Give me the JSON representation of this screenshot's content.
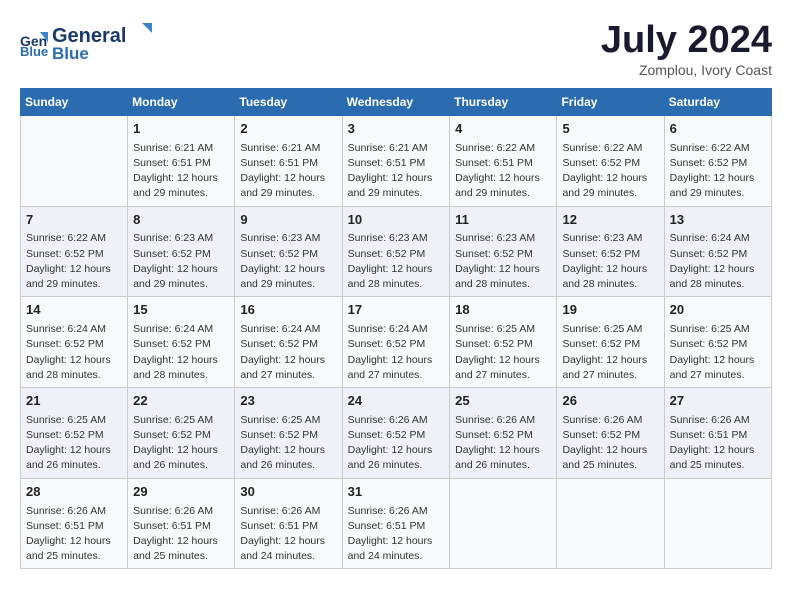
{
  "header": {
    "logo_line1": "General",
    "logo_line2": "Blue",
    "month_year": "July 2024",
    "location": "Zomplou, Ivory Coast"
  },
  "days_of_week": [
    "Sunday",
    "Monday",
    "Tuesday",
    "Wednesday",
    "Thursday",
    "Friday",
    "Saturday"
  ],
  "weeks": [
    [
      {
        "day": "",
        "info": ""
      },
      {
        "day": "1",
        "info": "Sunrise: 6:21 AM\nSunset: 6:51 PM\nDaylight: 12 hours\nand 29 minutes."
      },
      {
        "day": "2",
        "info": "Sunrise: 6:21 AM\nSunset: 6:51 PM\nDaylight: 12 hours\nand 29 minutes."
      },
      {
        "day": "3",
        "info": "Sunrise: 6:21 AM\nSunset: 6:51 PM\nDaylight: 12 hours\nand 29 minutes."
      },
      {
        "day": "4",
        "info": "Sunrise: 6:22 AM\nSunset: 6:51 PM\nDaylight: 12 hours\nand 29 minutes."
      },
      {
        "day": "5",
        "info": "Sunrise: 6:22 AM\nSunset: 6:52 PM\nDaylight: 12 hours\nand 29 minutes."
      },
      {
        "day": "6",
        "info": "Sunrise: 6:22 AM\nSunset: 6:52 PM\nDaylight: 12 hours\nand 29 minutes."
      }
    ],
    [
      {
        "day": "7",
        "info": "Sunrise: 6:22 AM\nSunset: 6:52 PM\nDaylight: 12 hours\nand 29 minutes."
      },
      {
        "day": "8",
        "info": "Sunrise: 6:23 AM\nSunset: 6:52 PM\nDaylight: 12 hours\nand 29 minutes."
      },
      {
        "day": "9",
        "info": "Sunrise: 6:23 AM\nSunset: 6:52 PM\nDaylight: 12 hours\nand 29 minutes."
      },
      {
        "day": "10",
        "info": "Sunrise: 6:23 AM\nSunset: 6:52 PM\nDaylight: 12 hours\nand 28 minutes."
      },
      {
        "day": "11",
        "info": "Sunrise: 6:23 AM\nSunset: 6:52 PM\nDaylight: 12 hours\nand 28 minutes."
      },
      {
        "day": "12",
        "info": "Sunrise: 6:23 AM\nSunset: 6:52 PM\nDaylight: 12 hours\nand 28 minutes."
      },
      {
        "day": "13",
        "info": "Sunrise: 6:24 AM\nSunset: 6:52 PM\nDaylight: 12 hours\nand 28 minutes."
      }
    ],
    [
      {
        "day": "14",
        "info": "Sunrise: 6:24 AM\nSunset: 6:52 PM\nDaylight: 12 hours\nand 28 minutes."
      },
      {
        "day": "15",
        "info": "Sunrise: 6:24 AM\nSunset: 6:52 PM\nDaylight: 12 hours\nand 28 minutes."
      },
      {
        "day": "16",
        "info": "Sunrise: 6:24 AM\nSunset: 6:52 PM\nDaylight: 12 hours\nand 27 minutes."
      },
      {
        "day": "17",
        "info": "Sunrise: 6:24 AM\nSunset: 6:52 PM\nDaylight: 12 hours\nand 27 minutes."
      },
      {
        "day": "18",
        "info": "Sunrise: 6:25 AM\nSunset: 6:52 PM\nDaylight: 12 hours\nand 27 minutes."
      },
      {
        "day": "19",
        "info": "Sunrise: 6:25 AM\nSunset: 6:52 PM\nDaylight: 12 hours\nand 27 minutes."
      },
      {
        "day": "20",
        "info": "Sunrise: 6:25 AM\nSunset: 6:52 PM\nDaylight: 12 hours\nand 27 minutes."
      }
    ],
    [
      {
        "day": "21",
        "info": "Sunrise: 6:25 AM\nSunset: 6:52 PM\nDaylight: 12 hours\nand 26 minutes."
      },
      {
        "day": "22",
        "info": "Sunrise: 6:25 AM\nSunset: 6:52 PM\nDaylight: 12 hours\nand 26 minutes."
      },
      {
        "day": "23",
        "info": "Sunrise: 6:25 AM\nSunset: 6:52 PM\nDaylight: 12 hours\nand 26 minutes."
      },
      {
        "day": "24",
        "info": "Sunrise: 6:26 AM\nSunset: 6:52 PM\nDaylight: 12 hours\nand 26 minutes."
      },
      {
        "day": "25",
        "info": "Sunrise: 6:26 AM\nSunset: 6:52 PM\nDaylight: 12 hours\nand 26 minutes."
      },
      {
        "day": "26",
        "info": "Sunrise: 6:26 AM\nSunset: 6:52 PM\nDaylight: 12 hours\nand 25 minutes."
      },
      {
        "day": "27",
        "info": "Sunrise: 6:26 AM\nSunset: 6:51 PM\nDaylight: 12 hours\nand 25 minutes."
      }
    ],
    [
      {
        "day": "28",
        "info": "Sunrise: 6:26 AM\nSunset: 6:51 PM\nDaylight: 12 hours\nand 25 minutes."
      },
      {
        "day": "29",
        "info": "Sunrise: 6:26 AM\nSunset: 6:51 PM\nDaylight: 12 hours\nand 25 minutes."
      },
      {
        "day": "30",
        "info": "Sunrise: 6:26 AM\nSunset: 6:51 PM\nDaylight: 12 hours\nand 24 minutes."
      },
      {
        "day": "31",
        "info": "Sunrise: 6:26 AM\nSunset: 6:51 PM\nDaylight: 12 hours\nand 24 minutes."
      },
      {
        "day": "",
        "info": ""
      },
      {
        "day": "",
        "info": ""
      },
      {
        "day": "",
        "info": ""
      }
    ]
  ]
}
